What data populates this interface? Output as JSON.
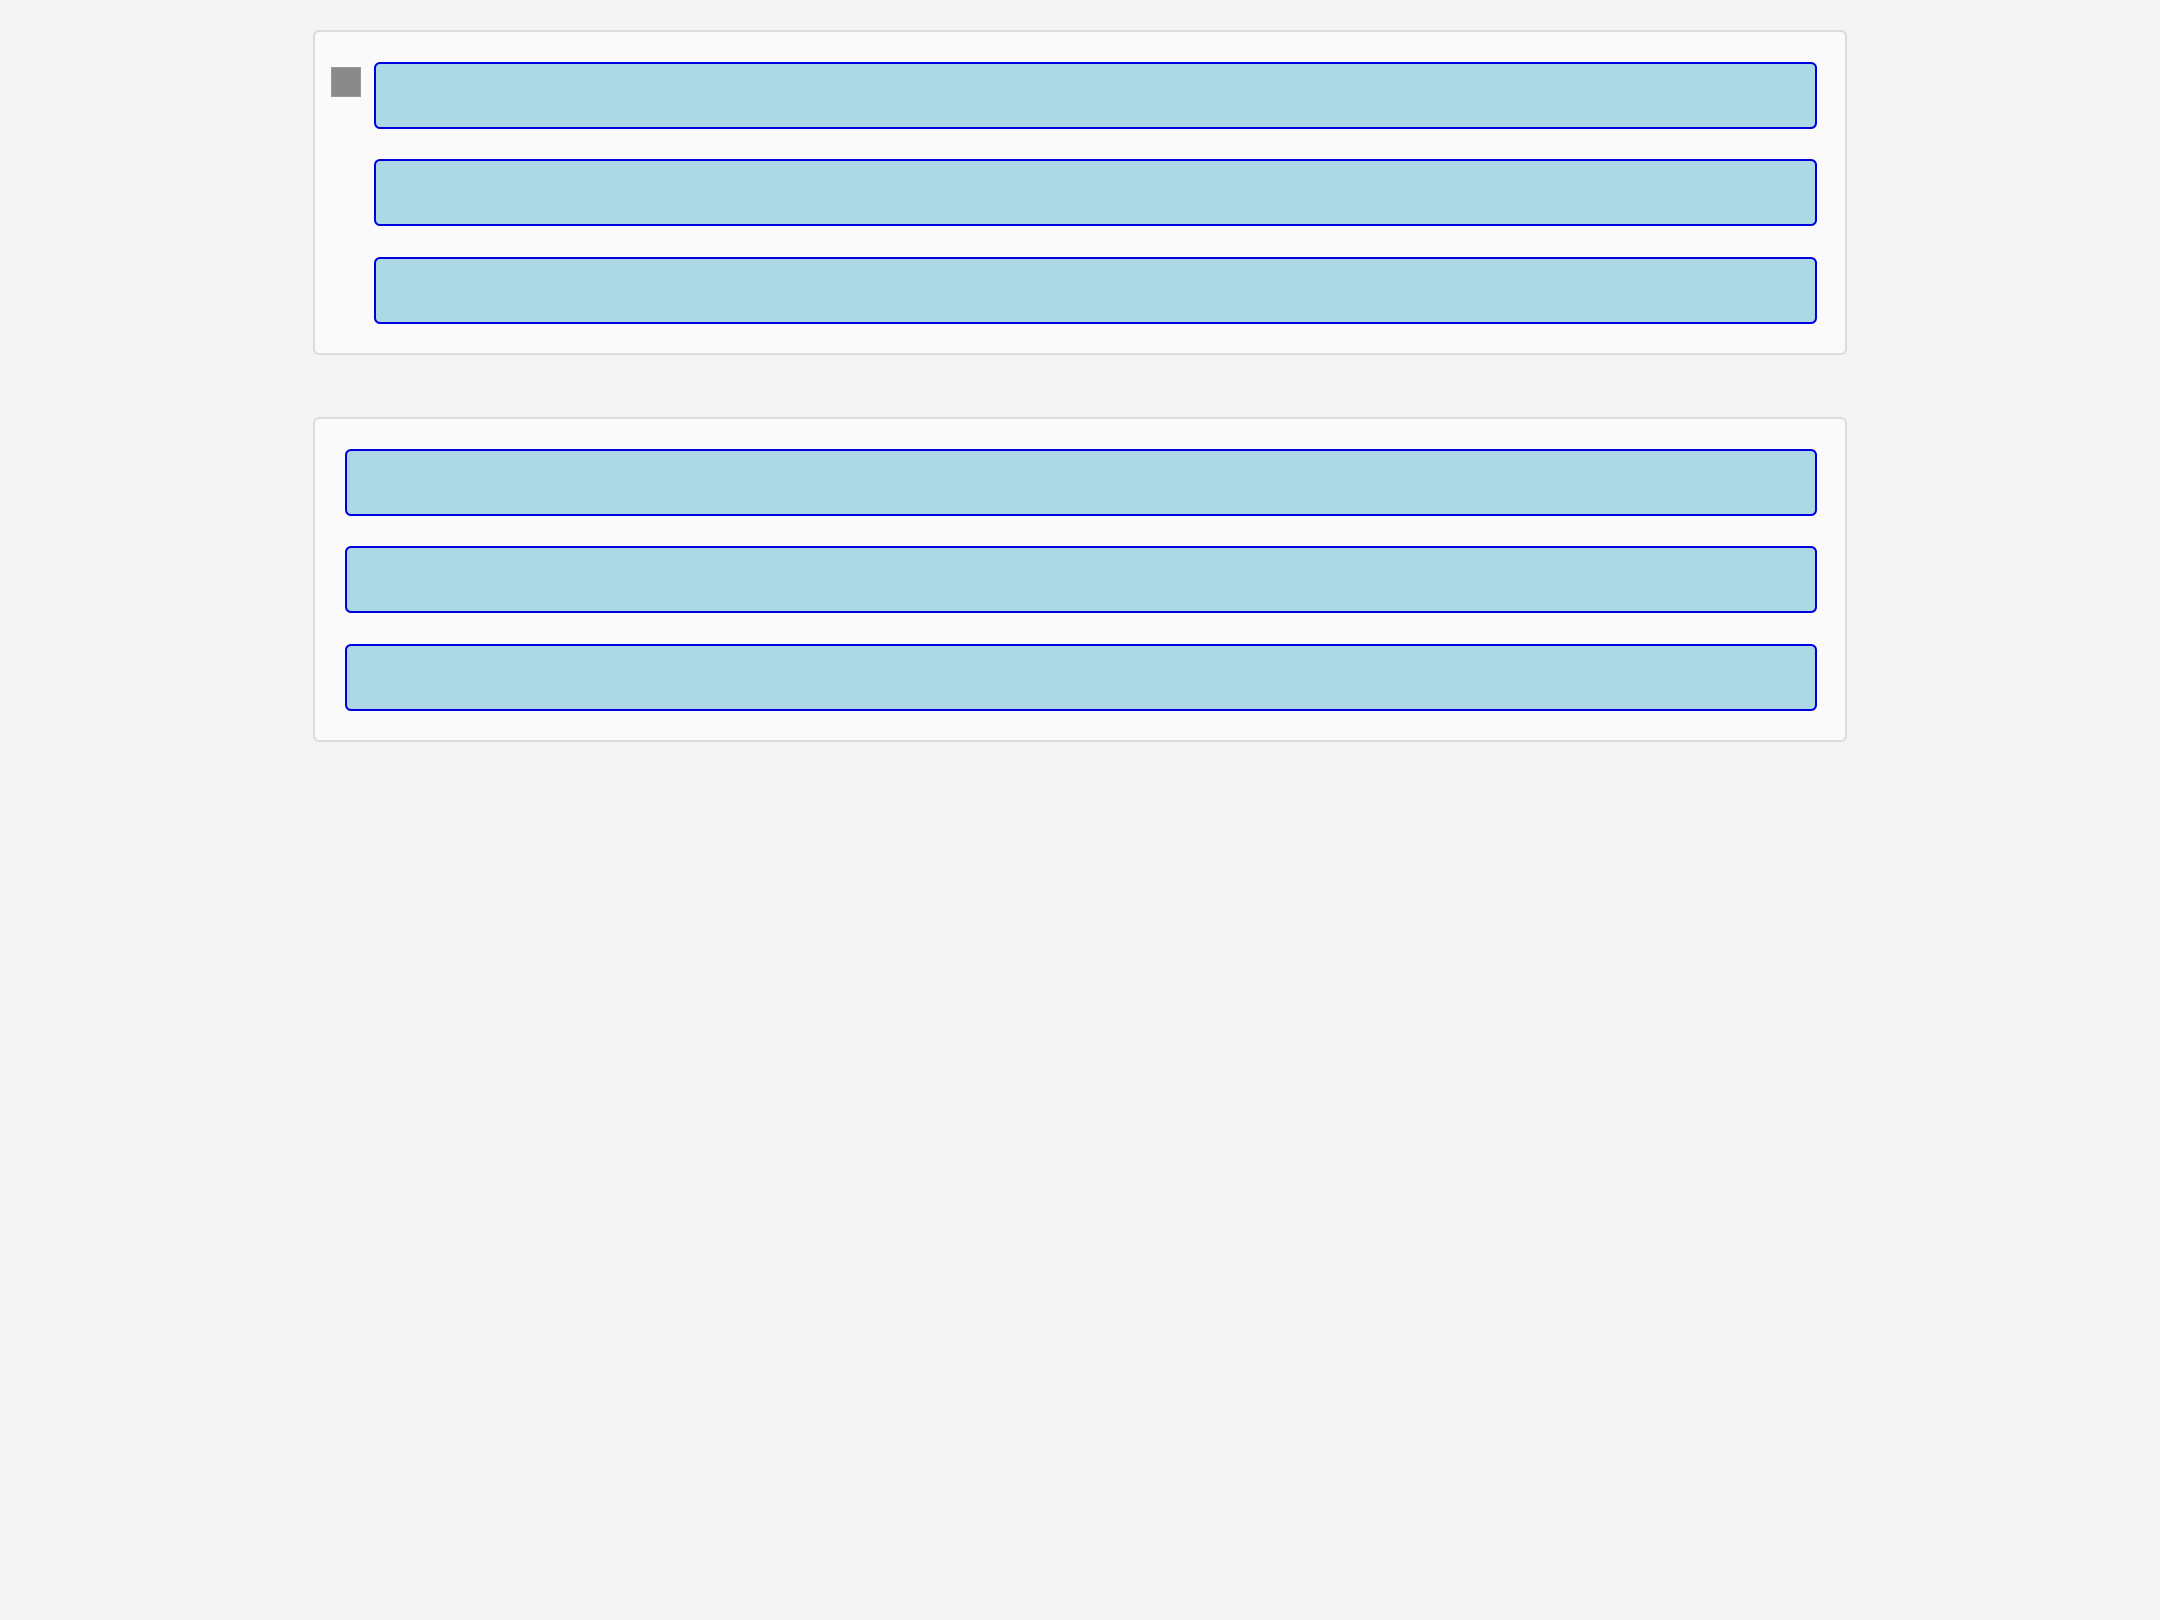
{
  "colors": {
    "page_background": "#f4f4f4",
    "panel_background": "#fafafa",
    "panel_border": "#dcdcdc",
    "item_fill": "#add8e6",
    "item_border": "#0000dd",
    "handle_fill": "#8a8a8a"
  },
  "panels": [
    {
      "items": [
        {
          "label": ""
        },
        {
          "label": ""
        },
        {
          "label": ""
        }
      ]
    },
    {
      "items": [
        {
          "label": ""
        },
        {
          "label": ""
        },
        {
          "label": ""
        }
      ]
    }
  ],
  "icons": {
    "handle": "square-icon"
  }
}
